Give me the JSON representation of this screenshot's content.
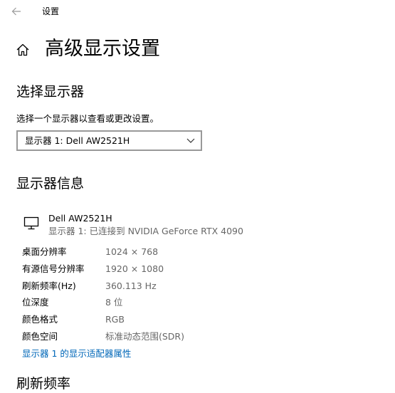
{
  "window": {
    "title": "设置"
  },
  "page": {
    "title": "高级显示设置"
  },
  "select_display": {
    "heading": "选择显示器",
    "description": "选择一个显示器以查看或更改设置。",
    "dropdown_value": "显示器 1: Dell AW2521H"
  },
  "display_info": {
    "heading": "显示器信息",
    "monitor_name": "Dell AW2521H",
    "connection": "显示器 1: 已连接到 NVIDIA GeForce RTX 4090",
    "rows": [
      {
        "label": "桌面分辨率",
        "value": "1024 × 768"
      },
      {
        "label": "有源信号分辨率",
        "value": "1920 × 1080"
      },
      {
        "label": "刷新频率(Hz)",
        "value": "360.113 Hz"
      },
      {
        "label": "位深度",
        "value": "8 位"
      },
      {
        "label": "颜色格式",
        "value": "RGB"
      },
      {
        "label": "颜色空间",
        "value": "标准动态范围(SDR)"
      }
    ],
    "adapter_link": "显示器 1 的显示适配器属性"
  },
  "refresh_rate": {
    "heading": "刷新频率"
  },
  "icons": {
    "back": "back-arrow-icon",
    "home": "home-icon",
    "dropdown": "chevron-down-icon",
    "monitor": "monitor-icon"
  },
  "colors": {
    "link": "#0067b8",
    "secondary_text": "#666666",
    "dropdown_border": "#999999"
  }
}
